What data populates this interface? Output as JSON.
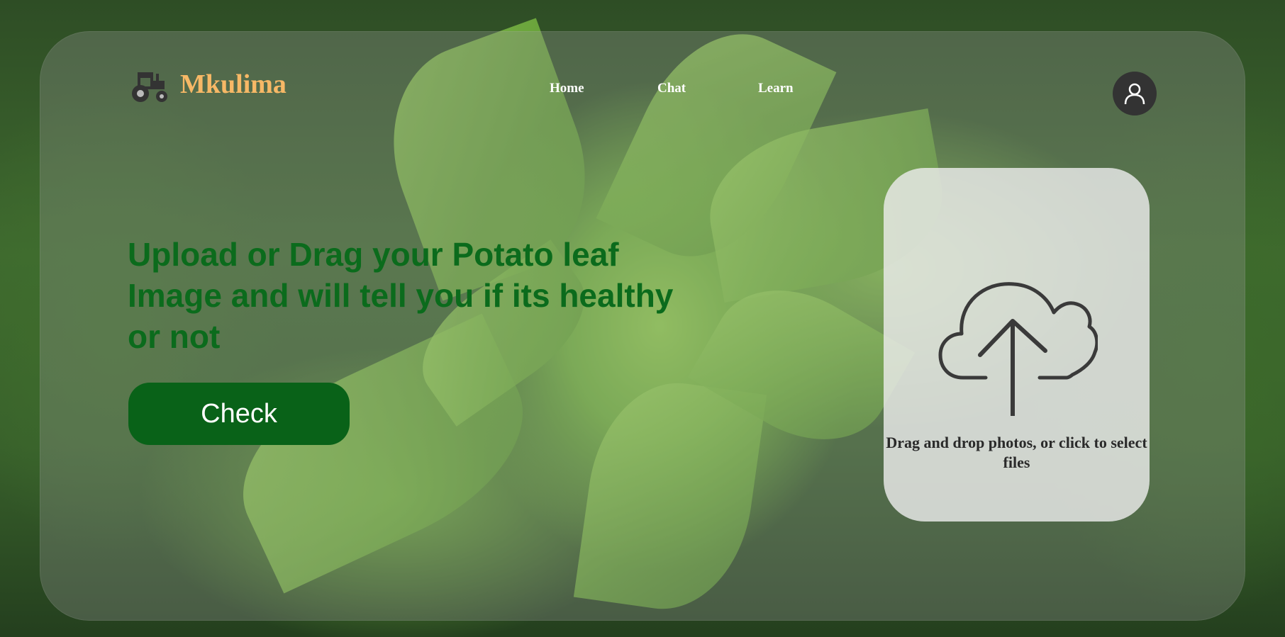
{
  "header": {
    "brand": "Mkulima",
    "logo_icon": "tractor-icon",
    "nav": [
      {
        "label": "Home"
      },
      {
        "label": "Chat"
      },
      {
        "label": "Learn"
      }
    ],
    "avatar_icon": "user-icon"
  },
  "hero": {
    "headline": "Upload or Drag your Potato leaf Image and will tell you if its healthy or not",
    "check_label": "Check"
  },
  "upload": {
    "icon": "cloud-upload-icon",
    "text": "Drag and drop photos, or click to select files"
  },
  "colors": {
    "brand": "#f7b866",
    "headline": "#0b6b1c",
    "button": "#096218"
  }
}
